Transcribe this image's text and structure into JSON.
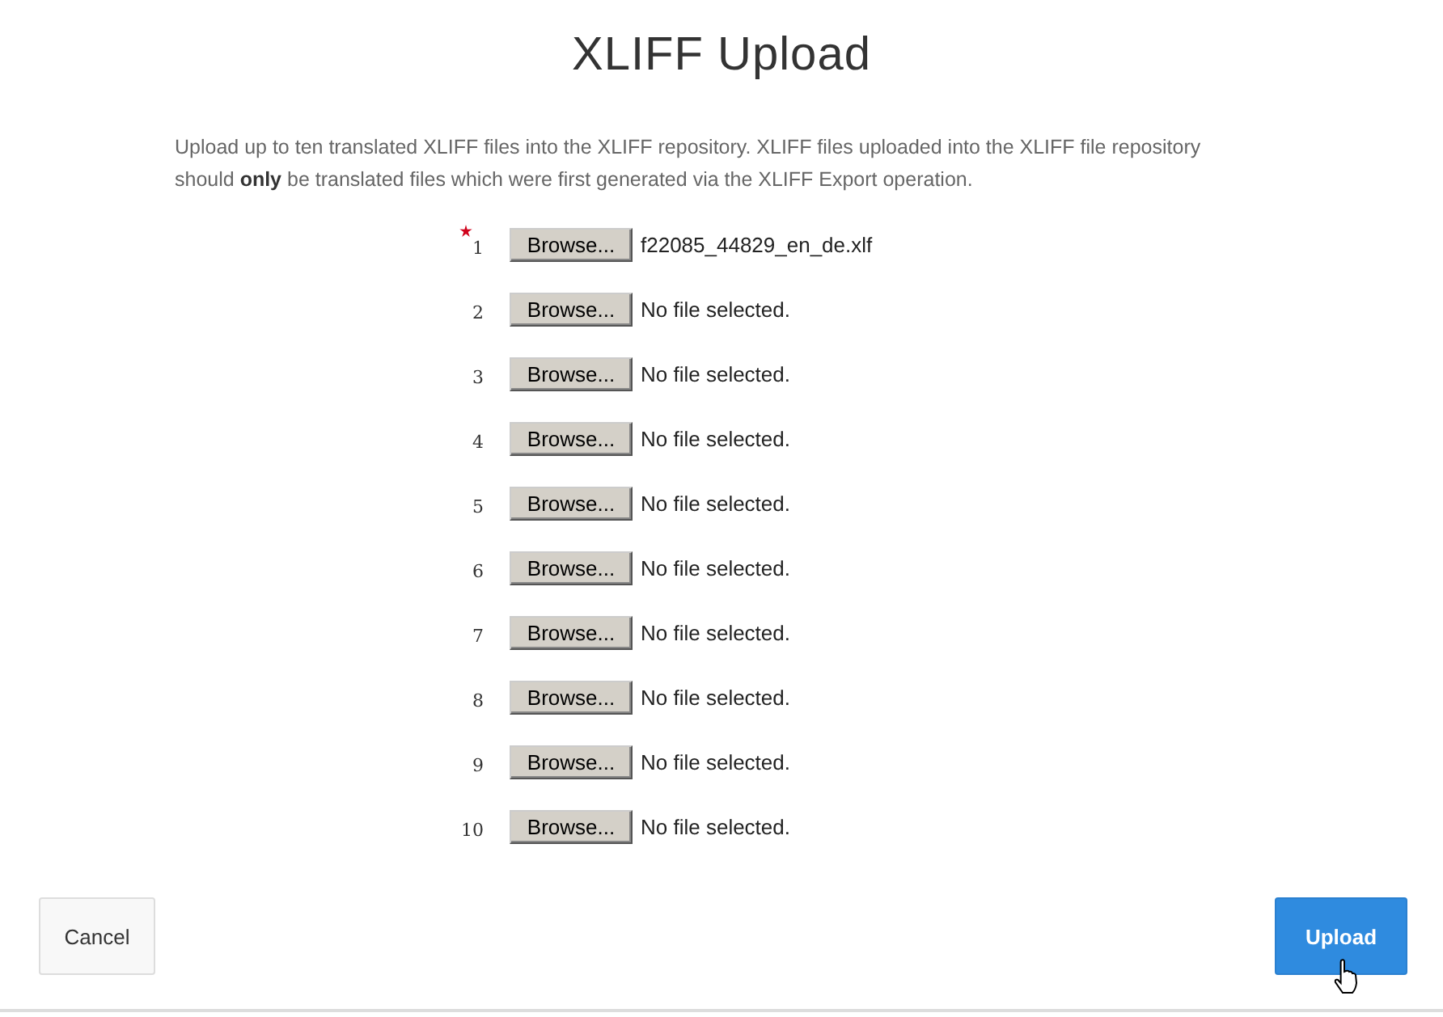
{
  "title": "XLIFF Upload",
  "description": "Upload up to ten translated XLIFF files into the XLIFF repository. XLIFF files uploaded into the XLIFF file repository should **only** be translated files which were first generated via the XLIFF Export operation.",
  "files": [
    {
      "number": "1",
      "required": true,
      "button": "Browse...",
      "file": "f22085_44829_en_de.xlf"
    },
    {
      "number": "2",
      "required": false,
      "button": "Browse...",
      "file": "No file selected."
    },
    {
      "number": "3",
      "required": false,
      "button": "Browse...",
      "file": "No file selected."
    },
    {
      "number": "4",
      "required": false,
      "button": "Browse...",
      "file": "No file selected."
    },
    {
      "number": "5",
      "required": false,
      "button": "Browse...",
      "file": "No file selected."
    },
    {
      "number": "6",
      "required": false,
      "button": "Browse...",
      "file": "No file selected."
    },
    {
      "number": "7",
      "required": false,
      "button": "Browse...",
      "file": "No file selected."
    },
    {
      "number": "8",
      "required": false,
      "button": "Browse...",
      "file": "No file selected."
    },
    {
      "number": "9",
      "required": false,
      "button": "Browse...",
      "file": "No file selected."
    },
    {
      "number": "10",
      "required": false,
      "button": "Browse...",
      "file": "No file selected."
    }
  ],
  "buttons": [
    {
      "label": "Cancel",
      "kind": "secondary"
    },
    {
      "label": "Upload",
      "kind": "primary"
    }
  ]
}
